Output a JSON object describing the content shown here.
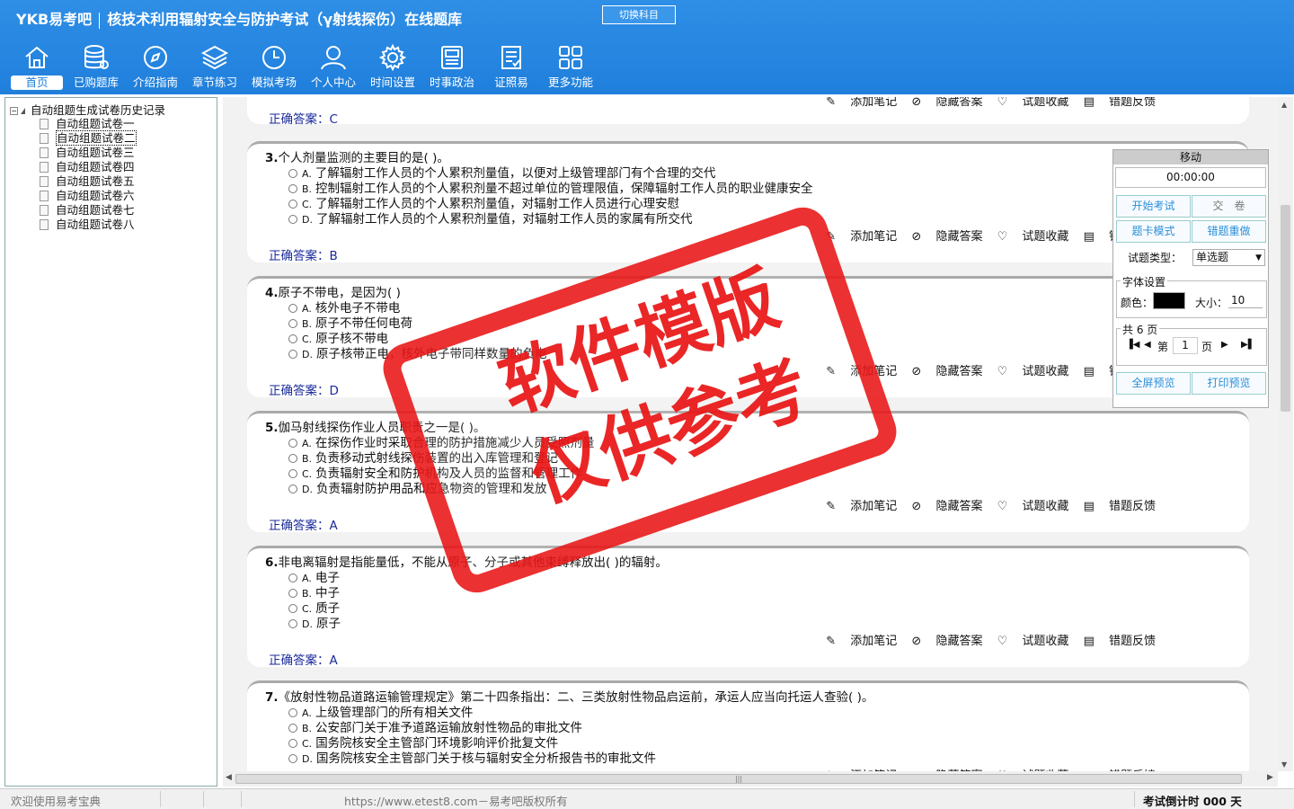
{
  "app": {
    "brand": "YKB易考吧",
    "title": "核技术利用辐射安全与防护考试（γ射线探伤）在线题库",
    "switch_subject": "切换科目"
  },
  "nav": [
    {
      "label": "首页",
      "icon": "home-icon"
    },
    {
      "label": "已购题库",
      "icon": "database-icon"
    },
    {
      "label": "介绍指南",
      "icon": "compass-icon"
    },
    {
      "label": "章节练习",
      "icon": "layers-icon"
    },
    {
      "label": "模拟考场",
      "icon": "clock-icon"
    },
    {
      "label": "个人中心",
      "icon": "user-icon"
    },
    {
      "label": "时间设置",
      "icon": "gear-icon"
    },
    {
      "label": "时事政治",
      "icon": "news-icon"
    },
    {
      "label": "证照易",
      "icon": "certificate-icon"
    },
    {
      "label": "更多功能",
      "icon": "grid-icon"
    }
  ],
  "tree": {
    "root": "自动组题生成试卷历史记录",
    "items": [
      "自动组题试卷一",
      "自动组题试卷二",
      "自动组题试卷三",
      "自动组题试卷四",
      "自动组题试卷五",
      "自动组题试卷六",
      "自动组题试卷七",
      "自动组题试卷八"
    ]
  },
  "tools": {
    "note": "添加笔记",
    "hide": "隐藏答案",
    "fav": "试题收藏",
    "report": "错题反馈"
  },
  "answer_label": "正确答案：",
  "prev_answer": "C",
  "questions": [
    {
      "num": "3.",
      "stem": "个人剂量监测的主要目的是( )。",
      "options": [
        {
          "key": "A.",
          "text": "了解辐射工作人员的个人累积剂量值，以便对上级管理部门有个合理的交代"
        },
        {
          "key": "B.",
          "text": "控制辐射工作人员的个人累积剂量不超过单位的管理限值，保障辐射工作人员的职业健康安全"
        },
        {
          "key": "C.",
          "text": "了解辐射工作人员的个人累积剂量值，对辐射工作人员进行心理安慰"
        },
        {
          "key": "D.",
          "text": "了解辐射工作人员的个人累积剂量值，对辐射工作人员的家属有所交代"
        }
      ],
      "answer": "B"
    },
    {
      "num": "4.",
      "stem": "原子不带电，是因为( )",
      "options": [
        {
          "key": "A.",
          "text": "核外电子不带电"
        },
        {
          "key": "B.",
          "text": "原子不带任何电荷"
        },
        {
          "key": "C.",
          "text": "原子核不带电"
        },
        {
          "key": "D.",
          "text": "原子核带正电，核外电子带同样数量的负电"
        }
      ],
      "answer": "D"
    },
    {
      "num": "5.",
      "stem": "伽马射线探伤作业人员职责之一是( )。",
      "options": [
        {
          "key": "A.",
          "text": "在探伤作业时采取合理的防护措施减少人员受照剂量"
        },
        {
          "key": "B.",
          "text": "负责移动式射线探伤装置的出入库管理和登记"
        },
        {
          "key": "C.",
          "text": "负责辐射安全和防护机构及人员的监督和管理工作"
        },
        {
          "key": "D.",
          "text": "负责辐射防护用品和应急物资的管理和发放"
        }
      ],
      "answer": "A"
    },
    {
      "num": "6.",
      "stem": "非电离辐射是指能量低，不能从原子、分子或其他束缚释放出( )的辐射。",
      "options": [
        {
          "key": "A.",
          "text": "电子"
        },
        {
          "key": "B.",
          "text": "中子"
        },
        {
          "key": "C.",
          "text": "质子"
        },
        {
          "key": "D.",
          "text": "原子"
        }
      ],
      "answer": "A"
    },
    {
      "num": "7.",
      "stem": "《放射性物品道路运输管理规定》第二十四条指出：二、三类放射性物品启运前，承运人应当向托运人查验( )。",
      "options": [
        {
          "key": "A.",
          "text": "上级管理部门的所有相关文件"
        },
        {
          "key": "B.",
          "text": "公安部门关于准予道路运输放射性物品的审批文件"
        },
        {
          "key": "C.",
          "text": "国务院核安全主管部门环境影响评价批复文件"
        },
        {
          "key": "D.",
          "text": "国务院核安全主管部门关于核与辐射安全分析报告书的审批文件"
        }
      ],
      "answer": ""
    }
  ],
  "panel": {
    "title": "移动",
    "timer": "00:00:00",
    "start": "开始考试",
    "submit": "交　卷",
    "card_mode": "题卡模式",
    "redo": "错题重做",
    "type_label": "试题类型：",
    "type_value": "单选题",
    "font_group": "字体设置",
    "color_label": "颜色：",
    "size_label": "大小：",
    "size_value": "10",
    "color_value": "#000000",
    "pages_label": "共 6 页",
    "page_prefix": "第",
    "page_value": "1",
    "page_suffix": "页",
    "fullscreen": "全屏预览",
    "print": "打印预览"
  },
  "stamp": {
    "line1": "软件模版",
    "line2": "仅供参考"
  },
  "status": {
    "welcome": "欢迎使用易考宝典",
    "url": "https://www.etest8.com－易考吧版权所有",
    "countdown": "考试倒计时 000 天"
  }
}
